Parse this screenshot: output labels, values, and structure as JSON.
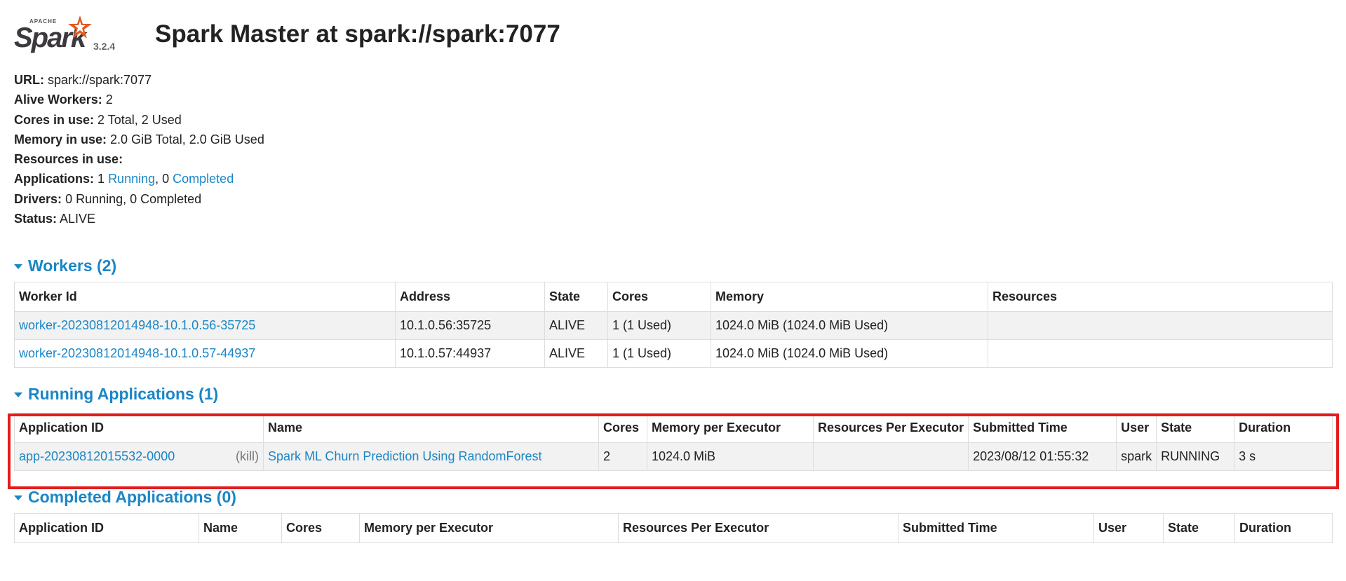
{
  "header": {
    "logo_apache": "APACHE",
    "logo_word": "Spark",
    "version": "3.2.4",
    "title": "Spark Master at spark://spark:7077"
  },
  "summary": {
    "url_label": "URL:",
    "url_value": "spark://spark:7077",
    "alive_workers_label": "Alive Workers:",
    "alive_workers_value": "2",
    "cores_label": "Cores in use:",
    "cores_value": "2 Total, 2 Used",
    "memory_label": "Memory in use:",
    "memory_value": "2.0 GiB Total, 2.0 GiB Used",
    "resources_label": "Resources in use:",
    "applications_label": "Applications:",
    "applications_running_count": "1",
    "applications_running_link": "Running",
    "applications_sep": ", 0",
    "applications_completed_link": "Completed",
    "drivers_label": "Drivers:",
    "drivers_value": "0 Running, 0 Completed",
    "status_label": "Status:",
    "status_value": "ALIVE"
  },
  "workers": {
    "title": "Workers (2)",
    "columns": [
      "Worker Id",
      "Address",
      "State",
      "Cores",
      "Memory",
      "Resources"
    ],
    "rows": [
      {
        "id": "worker-20230812014948-10.1.0.56-35725",
        "address": "10.1.0.56:35725",
        "state": "ALIVE",
        "cores": "1 (1 Used)",
        "memory": "1024.0 MiB (1024.0 MiB Used)",
        "resources": ""
      },
      {
        "id": "worker-20230812014948-10.1.0.57-44937",
        "address": "10.1.0.57:44937",
        "state": "ALIVE",
        "cores": "1 (1 Used)",
        "memory": "1024.0 MiB (1024.0 MiB Used)",
        "resources": ""
      }
    ]
  },
  "running_apps": {
    "title": "Running Applications (1)",
    "columns": [
      "Application ID",
      "Name",
      "Cores",
      "Memory per Executor",
      "Resources Per Executor",
      "Submitted Time",
      "User",
      "State",
      "Duration"
    ],
    "rows": [
      {
        "id": "app-20230812015532-0000",
        "kill": "(kill)",
        "name": "Spark ML Churn Prediction Using RandomForest",
        "cores": "2",
        "memory": "1024.0 MiB",
        "resources": "",
        "submitted": "2023/08/12 01:55:32",
        "user": "spark",
        "state": "RUNNING",
        "duration": "3 s"
      }
    ]
  },
  "completed_apps": {
    "title": "Completed Applications (0)",
    "columns": [
      "Application ID",
      "Name",
      "Cores",
      "Memory per Executor",
      "Resources Per Executor",
      "Submitted Time",
      "User",
      "State",
      "Duration"
    ]
  },
  "colors": {
    "link": "#1a86c6",
    "highlight": "#e31c1c",
    "odd_row": "#f2f2f2"
  }
}
